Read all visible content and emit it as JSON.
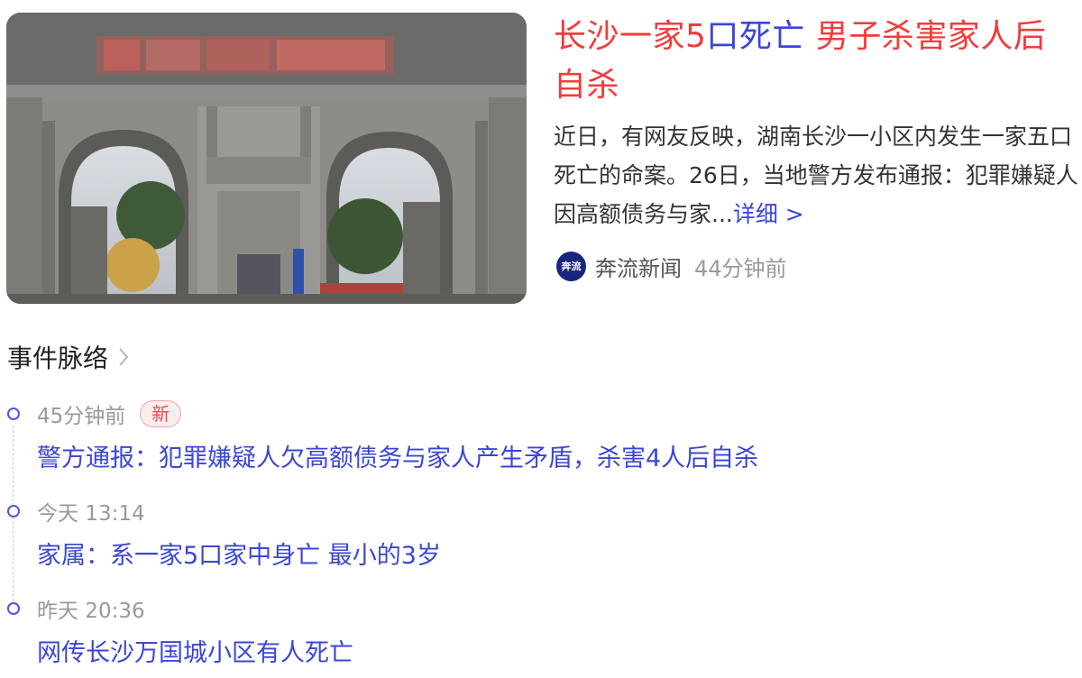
{
  "news": {
    "title_part1": "长沙一家5",
    "title_part2": "口死亡",
    "title_part3": " 男子杀害家人后自杀",
    "summary": "近日，有网友反映，湖南长沙一小区内发生一家五口死亡的命案。26日，当地警方发布通报：犯罪嫌疑人因高额债务与家...",
    "more_link": "详细 >",
    "source_logo_text": "奔流",
    "source_name": "奔流新闻",
    "time_ago": "44分钟前",
    "image_icon": "gated-community-entrance-photo"
  },
  "timeline": {
    "title": "事件脉络",
    "items": [
      {
        "time": "45分钟前",
        "badge": "新",
        "headline": "警方通报：犯罪嫌疑人欠高额债务与家人产生矛盾，杀害4人后自杀"
      },
      {
        "time": "今天 13:14",
        "headline": "家属：系一家5口家中身亡 最小的3岁"
      },
      {
        "time": "昨天 20:36",
        "headline": "网传长沙万国城小区有人死亡"
      }
    ]
  },
  "colors": {
    "title_red": "#f33b3b",
    "link_blue": "#3b46d6",
    "badge_red": "#f04848",
    "source_logo_bg": "#1a2580"
  }
}
